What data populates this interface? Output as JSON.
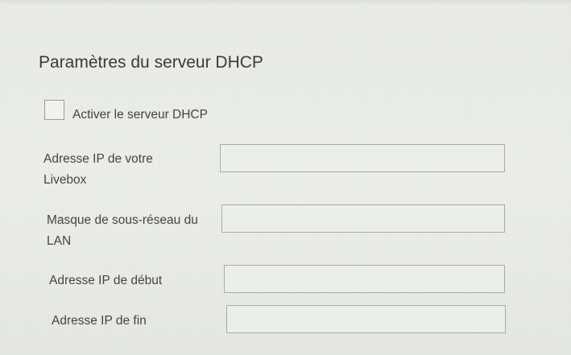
{
  "dhcp_settings": {
    "title": "Paramètres du serveur DHCP",
    "enable": {
      "label": "Activer le serveur DHCP",
      "checked": false
    },
    "fields": {
      "livebox_ip": {
        "label": "Adresse IP de votre\nLivebox",
        "value": ""
      },
      "subnet_mask": {
        "label": "Masque de sous-réseau du\nLAN",
        "value": ""
      },
      "start_ip": {
        "label": "Adresse IP de début",
        "value": ""
      },
      "end_ip": {
        "label": "Adresse IP de fin",
        "value": ""
      }
    }
  }
}
